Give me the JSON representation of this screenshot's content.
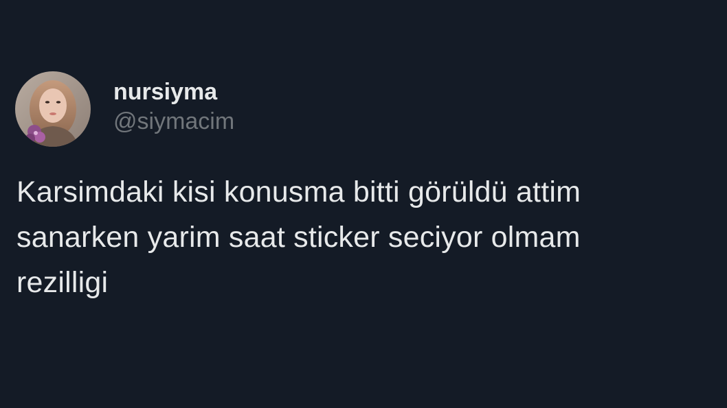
{
  "author": {
    "display_name": "nursiyma",
    "handle": "@siymacim",
    "avatar_icon": "profile-photo"
  },
  "tweet": {
    "text": "Karsimdaki kisi konusma bitti görüldü attim\nsanarken yarim saat sticker seciyor olmam\nrezilligi"
  },
  "colors": {
    "background": "#141b26",
    "text_primary": "#e7e9ea",
    "text_secondary": "#71767b"
  }
}
